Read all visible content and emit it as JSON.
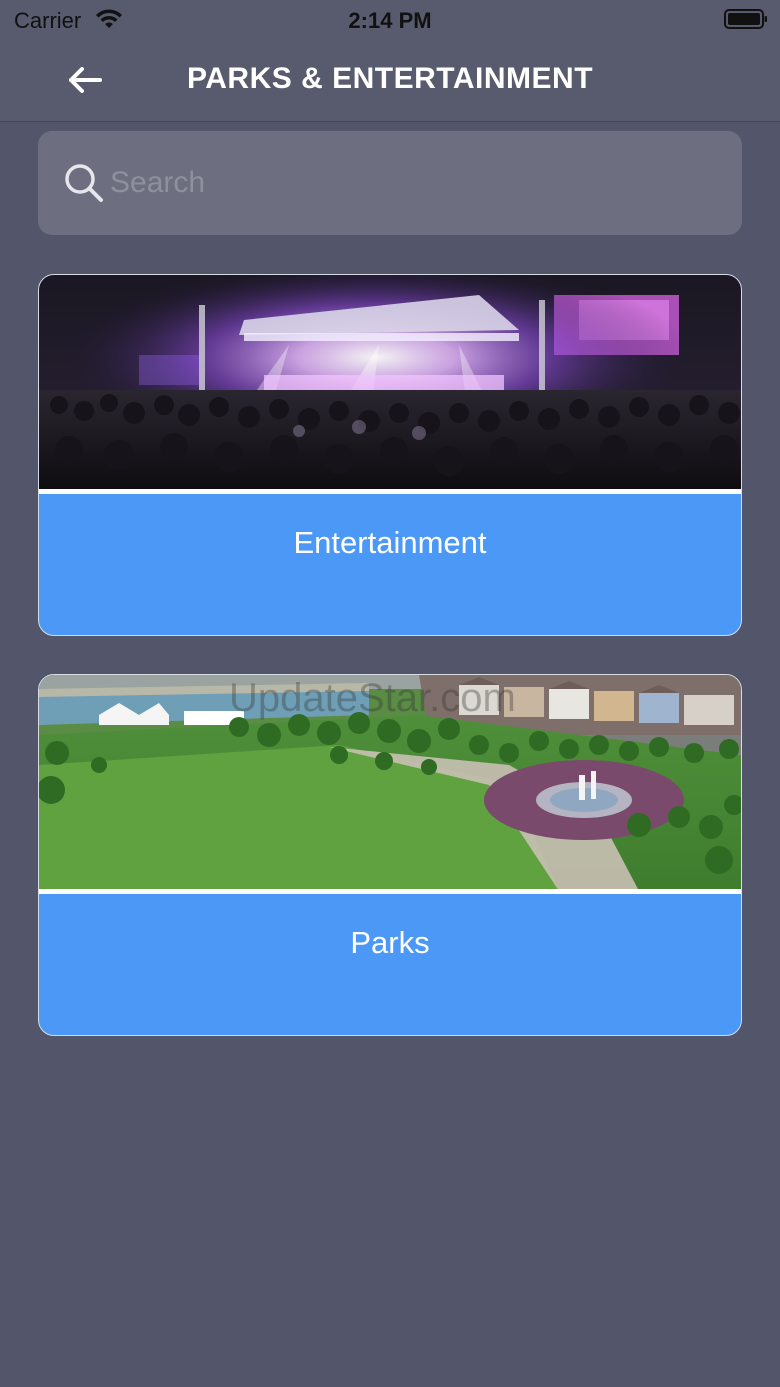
{
  "status_bar": {
    "carrier": "Carrier",
    "time": "2:14 PM"
  },
  "nav": {
    "title": "PARKS & ENTERTAINMENT",
    "back_icon": "arrow-left-icon"
  },
  "search": {
    "placeholder": "Search",
    "value": "",
    "icon": "search-icon"
  },
  "categories": [
    {
      "label": "Entertainment",
      "image": "concert-crowd-stage-photo"
    },
    {
      "label": "Parks",
      "image": "aerial-park-photo"
    }
  ],
  "watermark": "UpdateStar.com",
  "colors": {
    "background": "#53566a",
    "nav_bar": "#585b6e",
    "search_field": "#6d6f80",
    "card_accent": "#4b98f7"
  }
}
